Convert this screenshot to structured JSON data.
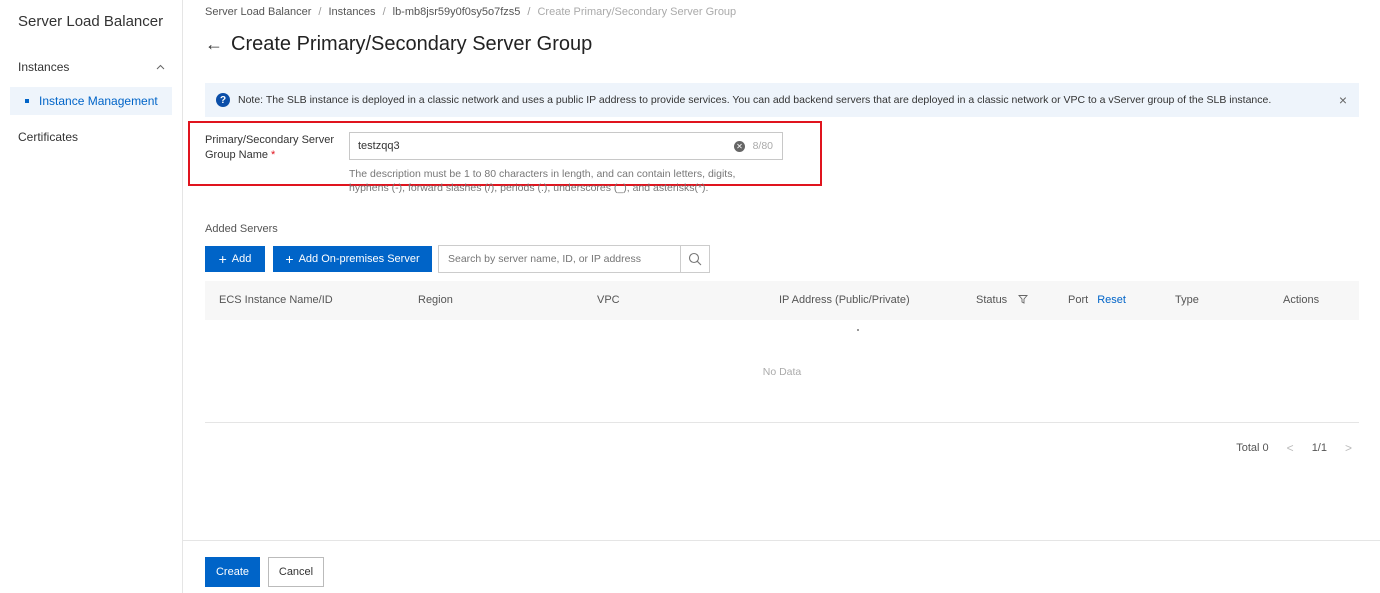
{
  "sidebar": {
    "title": "Server Load Balancer",
    "group_label": "Instances",
    "active_item": "Instance Management",
    "other_item": "Certificates"
  },
  "breadcrumb": {
    "items": [
      "Server Load Balancer",
      "Instances",
      "lb-mb8jsr59y0f0sy5o7fzs5",
      "Create Primary/Secondary Server Group"
    ],
    "separator": "/"
  },
  "page": {
    "back_icon": "←",
    "title": "Create Primary/Secondary Server Group"
  },
  "notice": {
    "icon": "?",
    "text": "Note: The SLB instance is deployed in a classic network and uses a public IP address to provide services. You can add backend servers that are deployed in a classic network or VPC to a vServer group of the SLB instance.",
    "close": "×"
  },
  "form": {
    "name_label": "Primary/Secondary Server Group Name",
    "required_mark": "*",
    "name_value": "testzqq3",
    "char_count": "8/80",
    "help_text": "The description must be 1 to 80 characters in length, and can contain letters, digits, hyphens (-), forward slashes (/), periods (.), underscores (_), and asterisks(*)."
  },
  "servers": {
    "section_title": "Added Servers",
    "add_label": "Add",
    "add_onprem_label": "Add On-premises Server",
    "search_placeholder": "Search by server name, ID, or IP address"
  },
  "table": {
    "columns": {
      "ecs": "ECS Instance Name/ID",
      "region": "Region",
      "vpc": "VPC",
      "ip": "IP Address (Public/Private)",
      "status": "Status",
      "port": "Port",
      "reset": "Reset",
      "type": "Type",
      "actions": "Actions"
    },
    "empty_text": "No Data"
  },
  "pagination": {
    "total": "Total 0",
    "page": "1/1",
    "prev": "<",
    "next": ">"
  },
  "footer": {
    "create_label": "Create",
    "cancel_label": "Cancel"
  },
  "colors": {
    "primary": "#0064c8",
    "highlight_border": "#e0141e",
    "notice_bg": "#eef4fb"
  }
}
